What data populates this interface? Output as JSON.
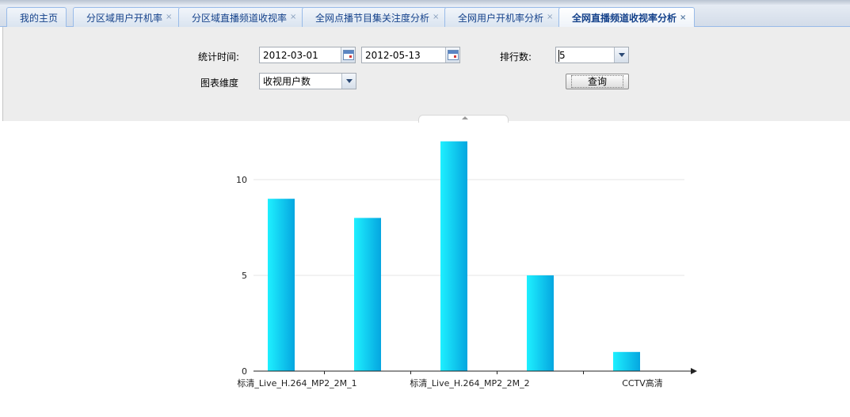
{
  "tabs": [
    {
      "label": "我的主页",
      "closable": false,
      "active": false
    },
    {
      "label": "分区域用户开机率",
      "closable": true,
      "active": false
    },
    {
      "label": "分区域直播频道收视率",
      "closable": true,
      "active": false
    },
    {
      "label": "全网点播节目集关注度分析",
      "closable": true,
      "active": false
    },
    {
      "label": "全网用户开机率分析",
      "closable": true,
      "active": false
    },
    {
      "label": "全网直播频道收视率分析",
      "closable": true,
      "active": true
    }
  ],
  "close_glyph": "×",
  "filters": {
    "time_label": "统计时间:",
    "start_date": "2012-03-01",
    "end_date": "2012-05-13",
    "rank_label": "排行数:",
    "rank_value": "5",
    "dimension_label": "图表维度",
    "dimension_value": "收视用户数",
    "query_button": "查询"
  },
  "icons": {
    "calendar": "calendar-icon",
    "dropdown": "chevron-down-icon",
    "collapse": "chevron-up-icon"
  },
  "colors": {
    "bar_light": "#1ef0ff",
    "bar_dark": "#05a6e0",
    "axis": "#222222",
    "grid": "#e6e6e6",
    "tab_text": "#15428b",
    "panel_bg": "#ededed"
  },
  "chart_data": {
    "type": "bar",
    "categories": [
      "标清_Live_H.264_MP2_2M_1",
      "",
      "标清_Live_H.264_MP2_2M_2",
      "",
      "CCTV高清"
    ],
    "values": [
      9,
      8,
      12,
      5,
      1
    ],
    "yticks": [
      0,
      5,
      10
    ],
    "ylim": [
      0,
      13
    ],
    "grid": true,
    "legend": "none"
  }
}
